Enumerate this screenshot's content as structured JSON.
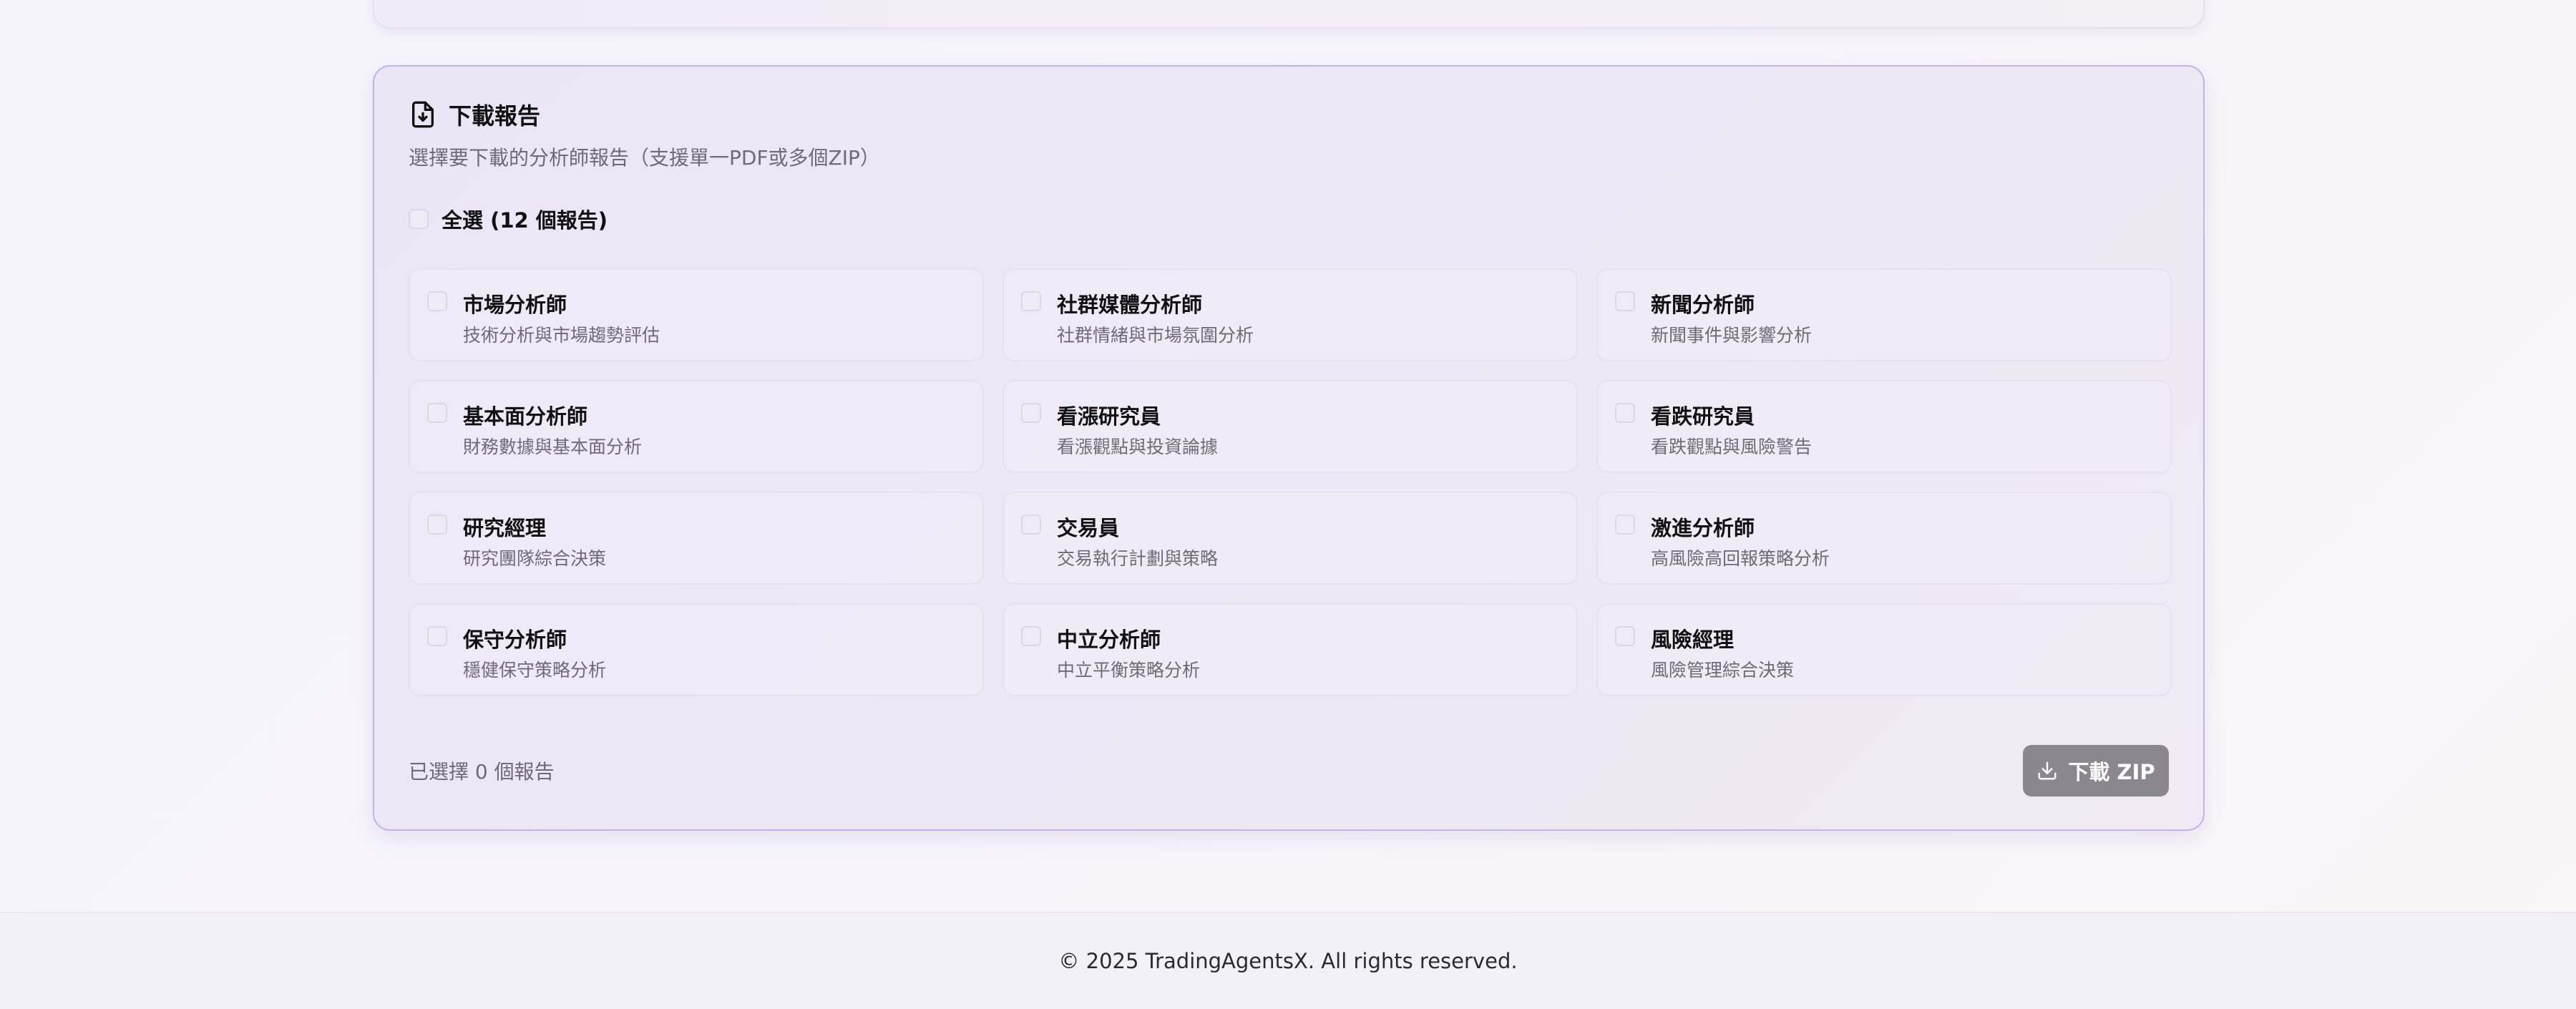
{
  "download_card": {
    "icon": "file-download-icon",
    "title": "下載報告",
    "subtitle": "選擇要下載的分析師報告（支援單一PDF或多個ZIP）",
    "select_all_label": "全選 (12 個報告)",
    "items": [
      {
        "title": "市場分析師",
        "desc": "技術分析與市場趨勢評估"
      },
      {
        "title": "社群媒體分析師",
        "desc": "社群情緒與市場氛圍分析"
      },
      {
        "title": "新聞分析師",
        "desc": "新聞事件與影響分析"
      },
      {
        "title": "基本面分析師",
        "desc": "財務數據與基本面分析"
      },
      {
        "title": "看漲研究員",
        "desc": "看漲觀點與投資論據"
      },
      {
        "title": "看跌研究員",
        "desc": "看跌觀點與風險警告"
      },
      {
        "title": "研究經理",
        "desc": "研究團隊綜合決策"
      },
      {
        "title": "交易員",
        "desc": "交易執行計劃與策略"
      },
      {
        "title": "激進分析師",
        "desc": "高風險高回報策略分析"
      },
      {
        "title": "保守分析師",
        "desc": "穩健保守策略分析"
      },
      {
        "title": "中立分析師",
        "desc": "中立平衡策略分析"
      },
      {
        "title": "風險經理",
        "desc": "風險管理綜合決策"
      }
    ],
    "selected_count": "已選擇 0 個報告",
    "download_button_label": "下載 ZIP",
    "download_button_icon": "download-icon"
  },
  "footer": {
    "copyright": "© 2025 TradingAgentsX. All rights reserved."
  },
  "colors": {
    "card_border": "#bdb5ec",
    "button_bg": "#8b878f",
    "muted_text": "#6f6a78"
  }
}
